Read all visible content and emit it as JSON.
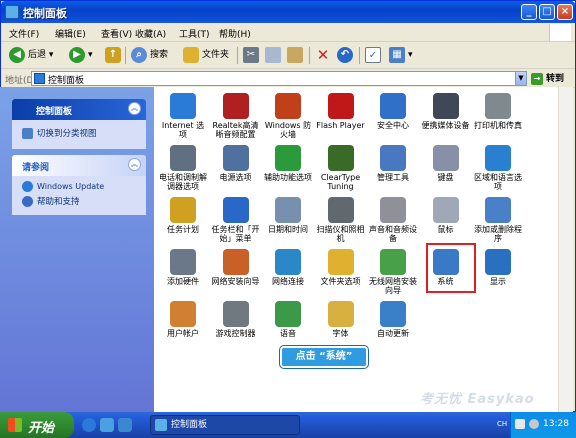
{
  "window": {
    "title": "控制面板"
  },
  "menu": [
    "文件(F)",
    "编辑(E)",
    "查看(V)",
    "收藏(A)",
    "工具(T)",
    "帮助(H)"
  ],
  "toolbar": {
    "back": "后退",
    "search": "搜索",
    "folders": "文件夹"
  },
  "address": {
    "label": "地址(D)",
    "value": "控制面板",
    "go": "转到"
  },
  "sidebar": {
    "panel1": {
      "title": "控制面板",
      "link": "切换到分类视图"
    },
    "panel2": {
      "title": "请参阅",
      "links": [
        "Windows Update",
        "帮助和支持"
      ]
    }
  },
  "items": [
    {
      "label": "Internet 选项",
      "icon": "globe-icon",
      "color": "#2a7ad8"
    },
    {
      "label": "Realtek高清晰音频配置",
      "icon": "speaker-icon",
      "color": "#b02020"
    },
    {
      "label": "Windows 防火墙",
      "icon": "firewall-icon",
      "color": "#c0401a"
    },
    {
      "label": "Flash Player",
      "icon": "flash-icon",
      "color": "#c01818"
    },
    {
      "label": "安全中心",
      "icon": "shield-icon",
      "color": "#3070c8"
    },
    {
      "label": "便携媒体设备",
      "icon": "media-device-icon",
      "color": "#404858"
    },
    {
      "label": "打印机和传真",
      "icon": "printer-icon",
      "color": "#808890"
    },
    {
      "label": "电话和调制解调器选项",
      "icon": "phone-icon",
      "color": "#607080"
    },
    {
      "label": "电源选项",
      "icon": "power-icon",
      "color": "#5070a0"
    },
    {
      "label": "辅助功能选项",
      "icon": "accessibility-icon",
      "color": "#2a9a3a"
    },
    {
      "label": "ClearType Tuning",
      "icon": "cleartype-icon",
      "color": "#3a6a28"
    },
    {
      "label": "管理工具",
      "icon": "admin-tools-icon",
      "color": "#4a78c0"
    },
    {
      "label": "键盘",
      "icon": "keyboard-icon",
      "color": "#8890a8"
    },
    {
      "label": "区域和语言选项",
      "icon": "region-icon",
      "color": "#2a80d0"
    },
    {
      "label": "任务计划",
      "icon": "scheduled-tasks-icon",
      "color": "#d0a020"
    },
    {
      "label": "任务栏和「开始」菜单",
      "icon": "taskbar-icon",
      "color": "#2a68c8"
    },
    {
      "label": "日期和时间",
      "icon": "clock-icon",
      "color": "#7890b0"
    },
    {
      "label": "扫描仪和照相机",
      "icon": "scanner-icon",
      "color": "#606870"
    },
    {
      "label": "声音和音频设备",
      "icon": "sound-icon",
      "color": "#909098"
    },
    {
      "label": "鼠标",
      "icon": "mouse-icon",
      "color": "#a0a8b8"
    },
    {
      "label": "添加或删除程序",
      "icon": "add-remove-icon",
      "color": "#4a80c8"
    },
    {
      "label": "添加硬件",
      "icon": "hardware-icon",
      "color": "#6a7888"
    },
    {
      "label": "网络安装向导",
      "icon": "network-wizard-icon",
      "color": "#c86028"
    },
    {
      "label": "网络连接",
      "icon": "network-icon",
      "color": "#2a88c8"
    },
    {
      "label": "文件夹选项",
      "icon": "folder-icon",
      "color": "#e0b030"
    },
    {
      "label": "无线网络安装向导",
      "icon": "wireless-icon",
      "color": "#48a048"
    },
    {
      "label": "系统",
      "icon": "system-icon",
      "color": "#3a78c8"
    },
    {
      "label": "显示",
      "icon": "display-icon",
      "color": "#2a70c0"
    },
    {
      "label": "用户帐户",
      "icon": "users-icon",
      "color": "#d08030"
    },
    {
      "label": "游戏控制器",
      "icon": "gamepad-icon",
      "color": "#707880"
    },
    {
      "label": "语音",
      "icon": "speech-icon",
      "color": "#3a9a48"
    },
    {
      "label": "字体",
      "icon": "fonts-icon",
      "color": "#d8b040"
    },
    {
      "label": "自动更新",
      "icon": "update-icon",
      "color": "#3a80c8"
    }
  ],
  "callout": "点击 “系统”",
  "watermark": "考无忧 Easykao",
  "taskbar": {
    "start": "开始",
    "task": "控制面板",
    "lang": "CH",
    "time": "13:28"
  }
}
